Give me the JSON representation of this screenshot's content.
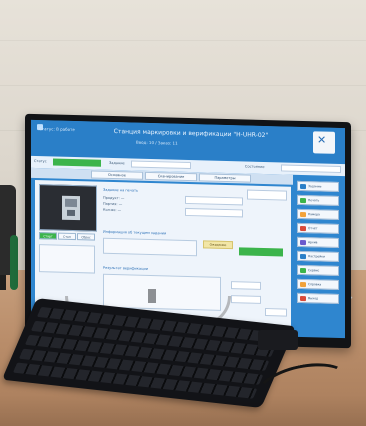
{
  "photo": {
    "subject": "Monitor on a desk showing a software window with a blue header, camera preview, and right sidebar buttons",
    "monitor_brand": "acer"
  },
  "screen": {
    "header": {
      "title": "Станция маркировки и верификации \"Н-UHR-02\"",
      "subtitle": "Ввод: 10 / Заказ: 11",
      "user": "Статус: В работе"
    },
    "statusbar": {
      "label_left": "Статус",
      "label_middle": "Задание",
      "field_right_label": "Состояние"
    },
    "tabs": [
      "Основное",
      "Сканирование",
      "Параметры"
    ],
    "content": {
      "camera_buttons": [
        "Старт",
        "Стоп",
        "Сброс"
      ],
      "section_title_1": "Задание на печать",
      "section_title_2": "Информация об текущем задании",
      "section_title_3": "Результат верификации",
      "yellow_status": "Ожидание",
      "info_lines": [
        "Продукт: —",
        "Партия: —",
        "Кол-во: —"
      ]
    },
    "sidebar_buttons": [
      {
        "label": "Задание",
        "color": "#2a7fc8"
      },
      {
        "label": "Печать",
        "color": "#3cb44b"
      },
      {
        "label": "Камера",
        "color": "#f2a23a"
      },
      {
        "label": "Отчёт",
        "color": "#d94a3a"
      },
      {
        "label": "Архив",
        "color": "#6a5acd"
      },
      {
        "label": "Настройки",
        "color": "#2a7fc8"
      },
      {
        "label": "Сервис",
        "color": "#3cb44b"
      },
      {
        "label": "Справка",
        "color": "#f2a23a"
      },
      {
        "label": "Выход",
        "color": "#d94a3a"
      }
    ]
  },
  "colors": {
    "screen_bg": "#2f86cf",
    "ok_green": "#3cb44b",
    "warn_yellow": "#f2e6a6"
  }
}
